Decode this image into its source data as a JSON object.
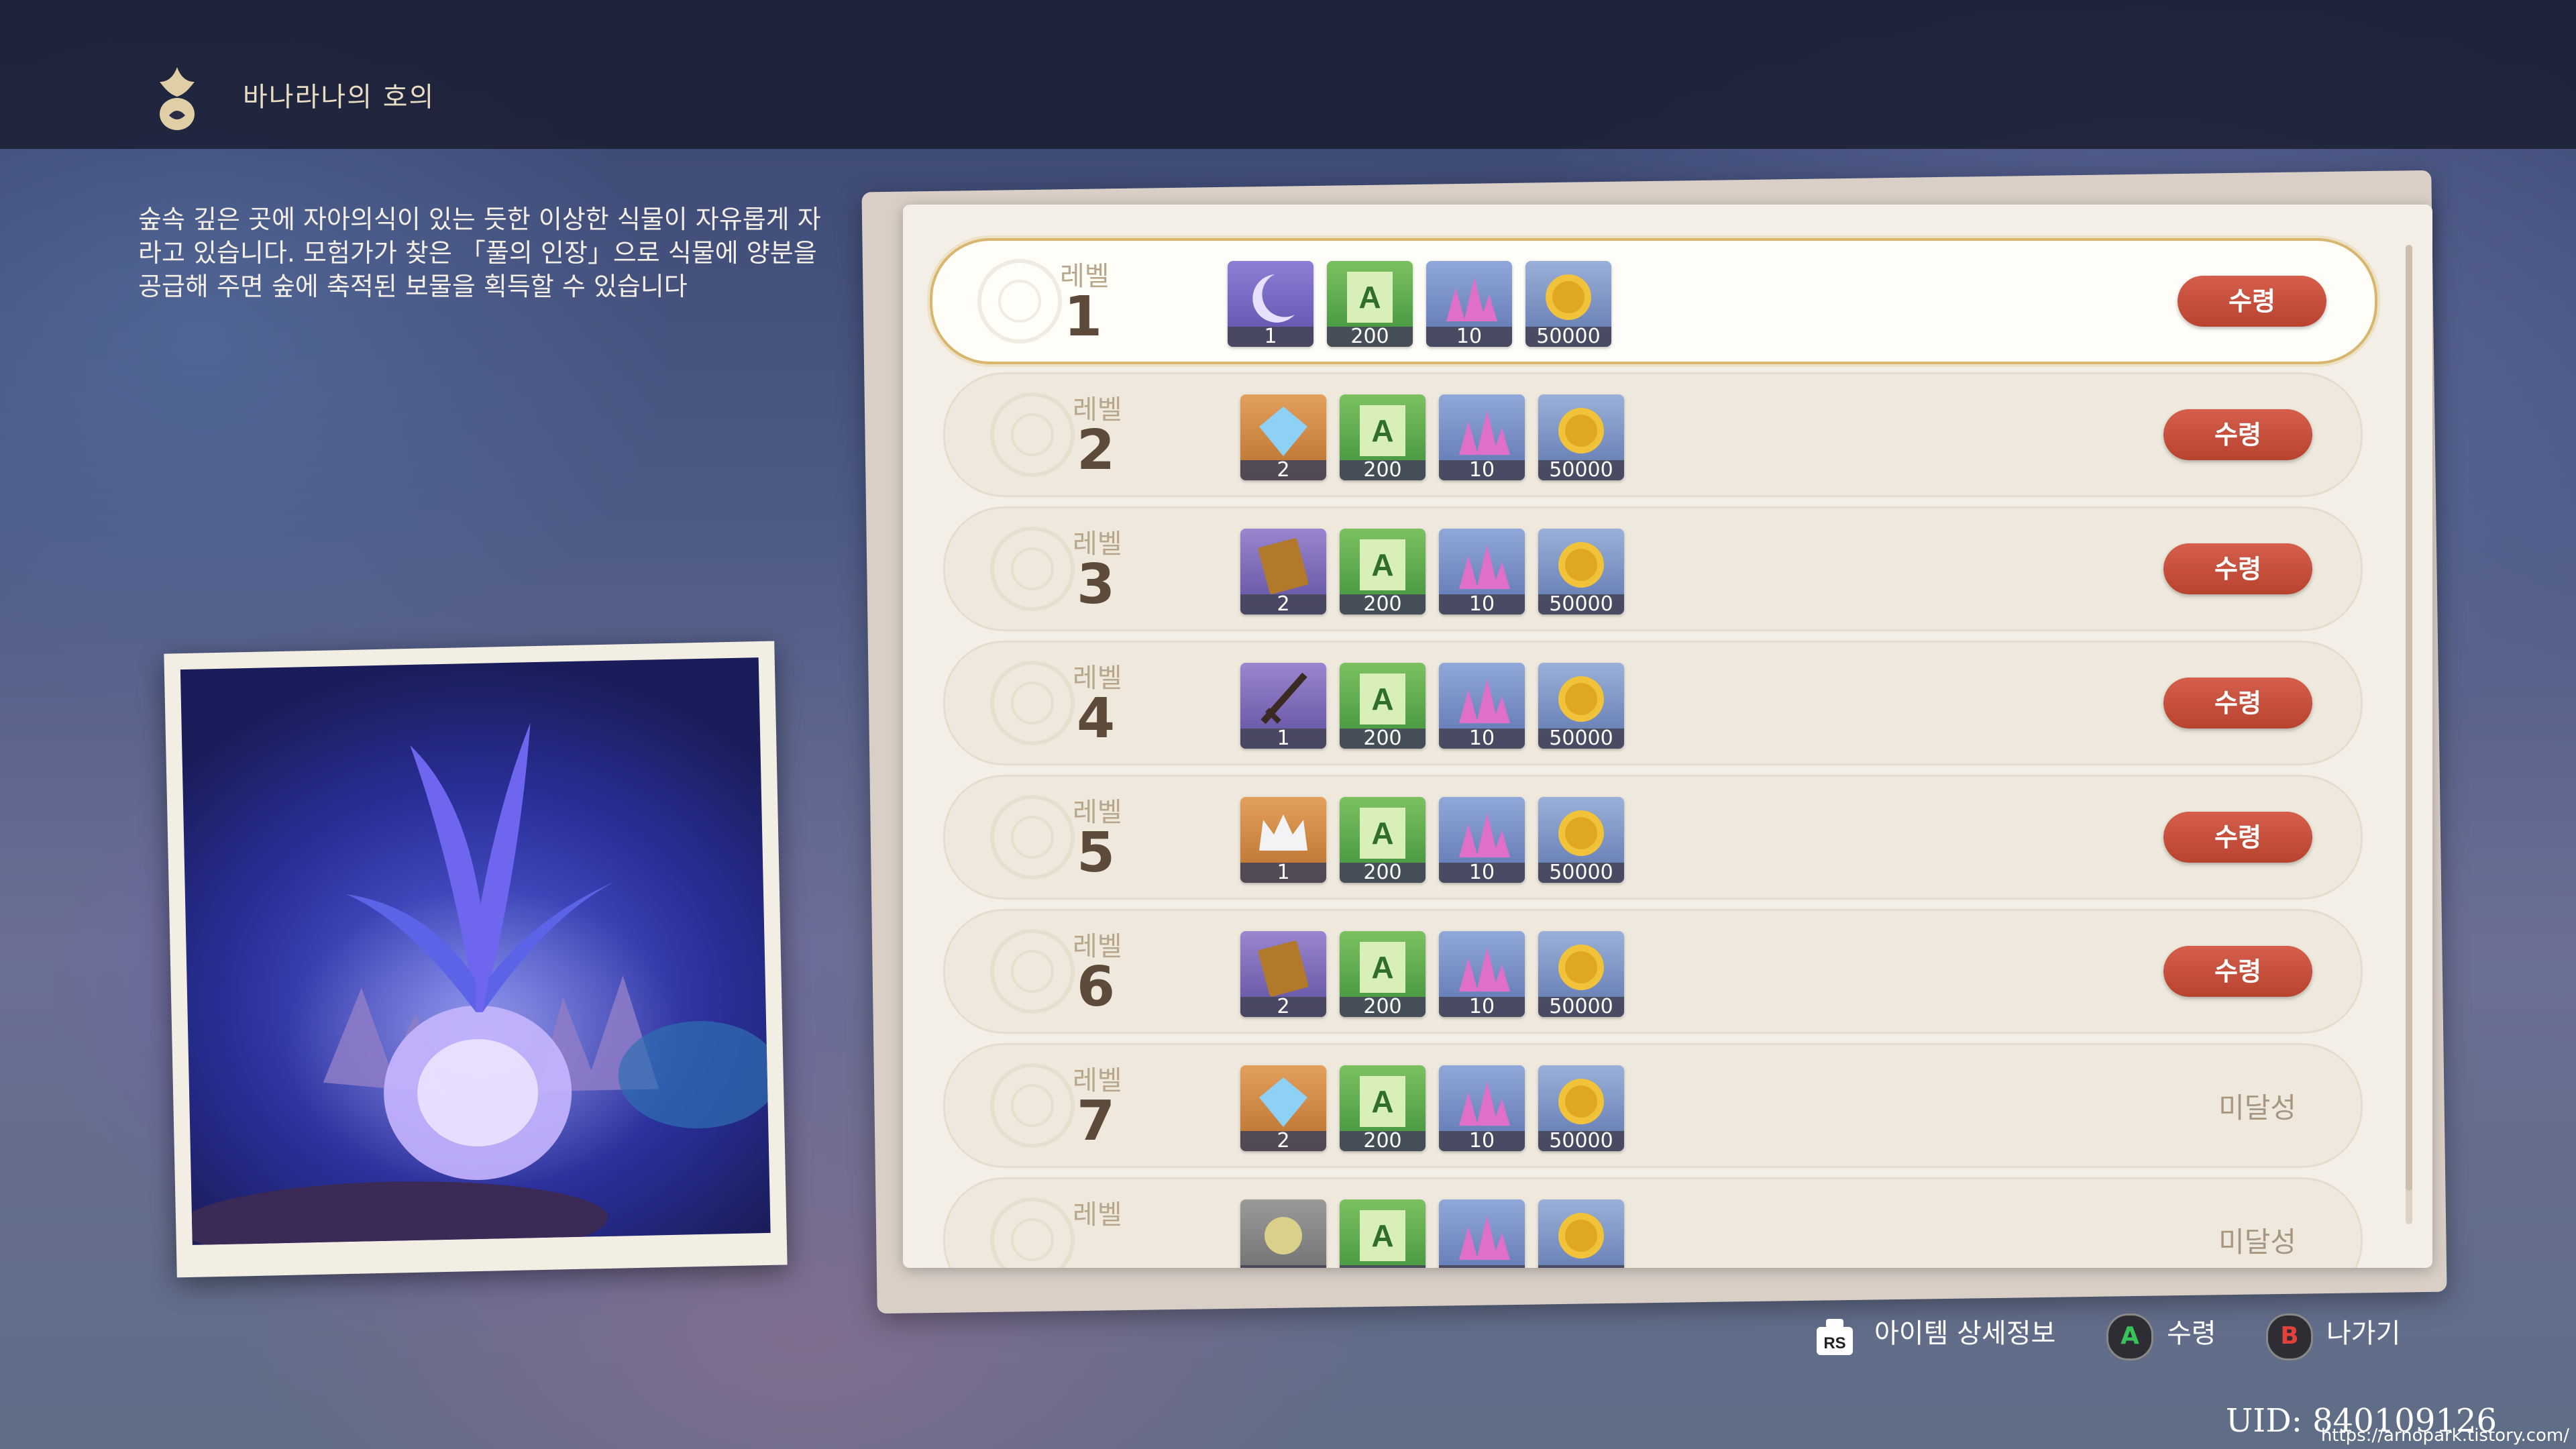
{
  "header": {
    "title": "바나라나의 호의",
    "icon": "banarana-emblem-icon"
  },
  "description": "숲속 깊은 곳에 자아의식이 있는 듯한 이상한 식물이 자유롭게 자라고 있습니다. 모험가가 찾은 「풀의 인장」으로 식물에 양분을 공급해 주면 숲에 축적된 보물을 획득할 수 있습니다",
  "levels": [
    {
      "label": "레벨",
      "number": "1",
      "action": "수령",
      "items": [
        {
          "icon": "moon-material-icon",
          "count": "1"
        },
        {
          "icon": "adventure-exp-icon",
          "count": "200"
        },
        {
          "icon": "crystal-ore-icon",
          "count": "10"
        },
        {
          "icon": "mora-coin-icon",
          "count": "50000"
        }
      ]
    },
    {
      "label": "레벨",
      "number": "2",
      "action": "수령",
      "items": [
        {
          "icon": "blue-gem-icon",
          "count": "2"
        },
        {
          "icon": "adventure-exp-icon",
          "count": "200"
        },
        {
          "icon": "crystal-ore-icon",
          "count": "10"
        },
        {
          "icon": "mora-coin-icon",
          "count": "50000"
        }
      ]
    },
    {
      "label": "레벨",
      "number": "3",
      "action": "수령",
      "items": [
        {
          "icon": "book-icon",
          "count": "2"
        },
        {
          "icon": "adventure-exp-icon",
          "count": "200"
        },
        {
          "icon": "crystal-ore-icon",
          "count": "10"
        },
        {
          "icon": "mora-coin-icon",
          "count": "50000"
        }
      ]
    },
    {
      "label": "레벨",
      "number": "4",
      "action": "수령",
      "items": [
        {
          "icon": "sword-icon",
          "count": "1"
        },
        {
          "icon": "adventure-exp-icon",
          "count": "200"
        },
        {
          "icon": "crystal-ore-icon",
          "count": "10"
        },
        {
          "icon": "mora-coin-icon",
          "count": "50000"
        }
      ]
    },
    {
      "label": "레벨",
      "number": "5",
      "action": "수령",
      "items": [
        {
          "icon": "crown-icon",
          "count": "1"
        },
        {
          "icon": "adventure-exp-icon",
          "count": "200"
        },
        {
          "icon": "crystal-ore-icon",
          "count": "10"
        },
        {
          "icon": "mora-coin-icon",
          "count": "50000"
        }
      ]
    },
    {
      "label": "레벨",
      "number": "6",
      "action": "수령",
      "items": [
        {
          "icon": "book-icon",
          "count": "2"
        },
        {
          "icon": "adventure-exp-icon",
          "count": "200"
        },
        {
          "icon": "crystal-ore-icon",
          "count": "10"
        },
        {
          "icon": "mora-coin-icon",
          "count": "50000"
        }
      ]
    },
    {
      "label": "레벨",
      "number": "7",
      "status": "미달성",
      "items": [
        {
          "icon": "blue-gem-icon",
          "count": "2"
        },
        {
          "icon": "adventure-exp-icon",
          "count": "200"
        },
        {
          "icon": "crystal-ore-icon",
          "count": "10"
        },
        {
          "icon": "mora-coin-icon",
          "count": "50000"
        }
      ]
    },
    {
      "label": "레벨",
      "number": "",
      "status": "미달성",
      "items": [
        {
          "icon": "gray-material-icon",
          "count": ""
        },
        {
          "icon": "adventure-exp-icon",
          "count": ""
        },
        {
          "icon": "crystal-ore-icon",
          "count": ""
        },
        {
          "icon": "mora-coin-icon",
          "count": ""
        }
      ]
    }
  ],
  "footer": {
    "hints": [
      {
        "key": "RS",
        "label": "아이템 상세정보"
      },
      {
        "key": "A",
        "label": "수령",
        "color": "#39c25a"
      },
      {
        "key": "B",
        "label": "나가기",
        "color": "#e0423b"
      }
    ],
    "uid": "UID: 840109126",
    "watermark": "https://arnopark.tistory.com/"
  },
  "colors": {
    "claim": "#c9503b",
    "accent": "#d8b66d"
  }
}
